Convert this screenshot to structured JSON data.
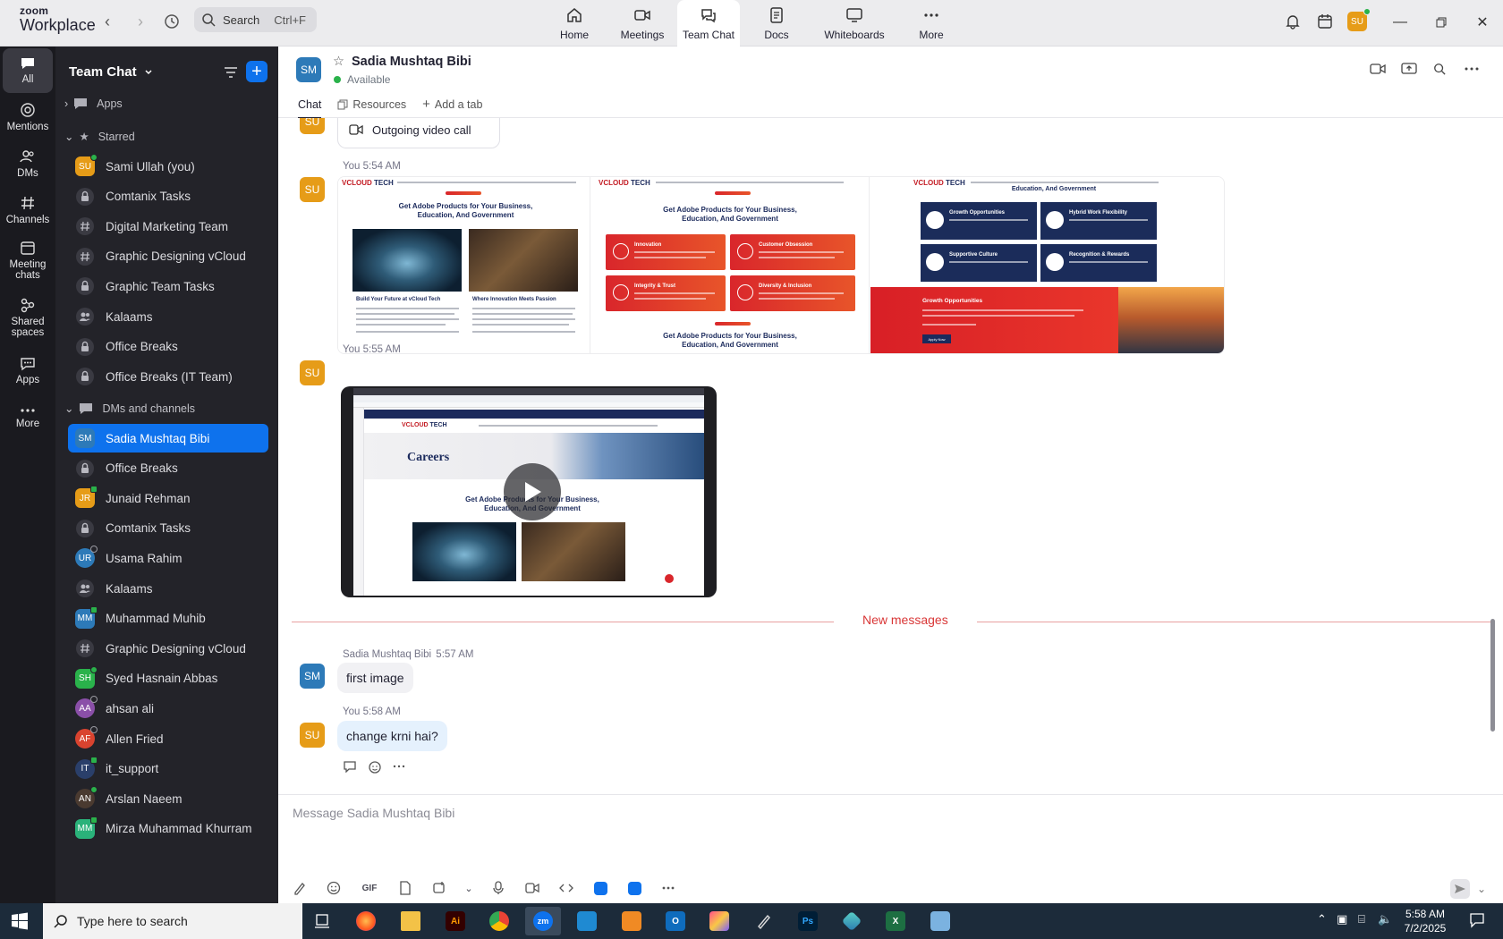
{
  "app": {
    "brand_top": "zoom",
    "brand_bottom": "Workplace",
    "search_placeholder": "Search",
    "search_shortcut": "Ctrl+F",
    "user_initials": "SU",
    "tabs": [
      {
        "label": "Home",
        "icon": "home-icon"
      },
      {
        "label": "Meetings",
        "icon": "video-camera-icon"
      },
      {
        "label": "Team Chat",
        "icon": "chat-icon",
        "active": true
      },
      {
        "label": "Docs",
        "icon": "docs-icon"
      },
      {
        "label": "Whiteboards",
        "icon": "whiteboard-icon"
      },
      {
        "label": "More",
        "icon": "more-icon"
      }
    ]
  },
  "rail": [
    {
      "label": "All",
      "icon": "chat-bubble-icon",
      "active": true
    },
    {
      "label": "Mentions",
      "icon": "at-icon"
    },
    {
      "label": "DMs",
      "icon": "people-icon"
    },
    {
      "label": "Channels",
      "icon": "hash-icon"
    },
    {
      "label": "Meeting chats",
      "icon": "calendar-icon"
    },
    {
      "label": "Shared spaces",
      "icon": "shared-spaces-icon"
    },
    {
      "label": "Apps",
      "icon": "apps-icon"
    },
    {
      "label": "More",
      "icon": "more-icon"
    }
  ],
  "sidebar": {
    "title": "Team Chat",
    "apps_label": "Apps",
    "starred_label": "Starred",
    "dms_label": "DMs and channels",
    "starred": [
      {
        "label": "Sami Ullah (you)",
        "kind": "avatar",
        "initials": "SU",
        "color": "#e69c18",
        "status": "online"
      },
      {
        "label": "Comtanix Tasks",
        "kind": "lock"
      },
      {
        "label": "Digital Marketing Team",
        "kind": "hash"
      },
      {
        "label": "Graphic Designing vCloud",
        "kind": "hash"
      },
      {
        "label": "Graphic Team Tasks",
        "kind": "lock"
      },
      {
        "label": "Kalaams",
        "kind": "group"
      },
      {
        "label": "Office Breaks",
        "kind": "lock"
      },
      {
        "label": "Office Breaks (IT Team)",
        "kind": "lock"
      }
    ],
    "dms": [
      {
        "label": "Sadia Mushtaq Bibi",
        "kind": "avatar",
        "initials": "SM",
        "color": "#2d7ab8",
        "selected": true
      },
      {
        "label": "Office Breaks",
        "kind": "lock"
      },
      {
        "label": "Junaid Rehman",
        "kind": "avatar",
        "initials": "JR",
        "color": "#e69c18",
        "status": "phone"
      },
      {
        "label": "Comtanix Tasks",
        "kind": "lock"
      },
      {
        "label": "Usama Rahim",
        "kind": "avatar",
        "initials": "UR",
        "color": "#2d7ab8",
        "status": "offline",
        "round": true
      },
      {
        "label": "Kalaams",
        "kind": "group"
      },
      {
        "label": "Muhammad Muhib",
        "kind": "avatar",
        "initials": "MM",
        "color": "#2d7ab8",
        "status": "phone"
      },
      {
        "label": "Graphic Designing vCloud",
        "kind": "hash"
      },
      {
        "label": "Syed Hasnain Abbas",
        "kind": "avatar",
        "initials": "SH",
        "color": "#2ab24b",
        "status": "online"
      },
      {
        "label": "ahsan ali",
        "kind": "avatar",
        "initials": "AA",
        "color": "#8a4fa8",
        "status": "offline",
        "round": true
      },
      {
        "label": "Allen Fried",
        "kind": "avatar",
        "initials": "AF",
        "color": "#d9432f",
        "status": "offline",
        "round": true
      },
      {
        "label": "it_support",
        "kind": "avatar",
        "initials": "IT",
        "color": "#2a3f6a",
        "status": "phone",
        "round": true
      },
      {
        "label": "Arslan Naeem",
        "kind": "avatar",
        "initials": "AN",
        "color": "#4a3a30",
        "status": "online",
        "round": true
      },
      {
        "label": "Mirza Muhammad Khurram",
        "kind": "avatar",
        "initials": "MM",
        "color": "#2ab27a",
        "status": "phone"
      }
    ]
  },
  "chat": {
    "contact_initials": "SM",
    "contact_name": "Sadia Mushtaq Bibi",
    "status": "Available",
    "tabs": {
      "chat": "Chat",
      "resources": "Resources",
      "add": "Add a tab"
    },
    "partial_avatar": "SU",
    "call_label": "Outgoing video call",
    "msg1_meta": "You 5:54 AM",
    "msg2_meta": "You 5:55 AM",
    "new_messages": "New messages",
    "msg3_sender": "Sadia Mushtaq Bibi",
    "msg3_time": "5:57 AM",
    "msg3_text": "first image",
    "msg4_meta": "You 5:58 AM",
    "msg4_text": "change krni hai?",
    "composer_placeholder": "Message Sadia Mushtaq Bibi",
    "gif_label": "GIF"
  },
  "images": {
    "logo_v": "VCLOUD",
    "logo_t": " TECH",
    "headline": "Get Adobe Products for Your Business, Education, And Government",
    "p1_left_title": "Build Your Future at vCloud Tech",
    "p1_right_title": "Where Innovation Meets Passion",
    "p2_cards": [
      "Innovation",
      "Customer Obsession",
      "Integrity & Trust",
      "Diversity & Inclusion"
    ],
    "p3_top": "Education, And Government",
    "p3_cards": [
      "Growth Opportunities",
      "Hybrid Work Flexibility",
      "Supportive Culture",
      "Recognition & Rewards"
    ],
    "p3_banner_title": "Growth Opportunities",
    "p3_button": "Apply Now",
    "video_title": "Careers"
  },
  "taskbar": {
    "search_placeholder": "Type here to search",
    "time": "5:58 AM",
    "date": "7/2/2025"
  }
}
